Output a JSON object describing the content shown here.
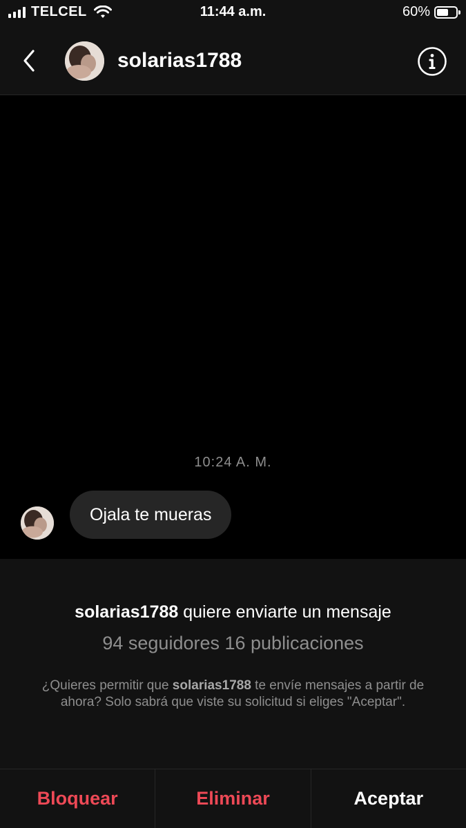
{
  "status_bar": {
    "carrier": "TELCEL",
    "time": "11:44 a.m.",
    "battery_percent": "60%",
    "battery_level": 0.6,
    "signal_icon": "signal-bars-icon",
    "wifi_icon": "wifi-icon"
  },
  "header": {
    "back_icon": "chevron-left-icon",
    "username": "solarias1788",
    "info_icon": "info-circle-icon"
  },
  "chat": {
    "timestamp": "10:24 A. M.",
    "messages": [
      {
        "text": "Ojala te mueras",
        "from": "solarias1788"
      }
    ]
  },
  "request": {
    "title_user": "solarias1788",
    "title_rest": " quiere enviarte un mensaje",
    "stats": "94 seguidores 16 publicaciones",
    "note_prefix": "¿Quieres permitir que ",
    "note_user": "solarias1788",
    "note_suffix": " te envíe mensajes a partir de ahora? Solo sabrá que viste su solicitud si eliges \"Aceptar\"."
  },
  "actions": {
    "block": "Bloquear",
    "delete": "Eliminar",
    "accept": "Aceptar"
  },
  "colors": {
    "background": "#000000",
    "panel": "#121212",
    "bubble": "#262626",
    "destructive": "#ed4956",
    "secondary_text": "#8e8e8e"
  }
}
